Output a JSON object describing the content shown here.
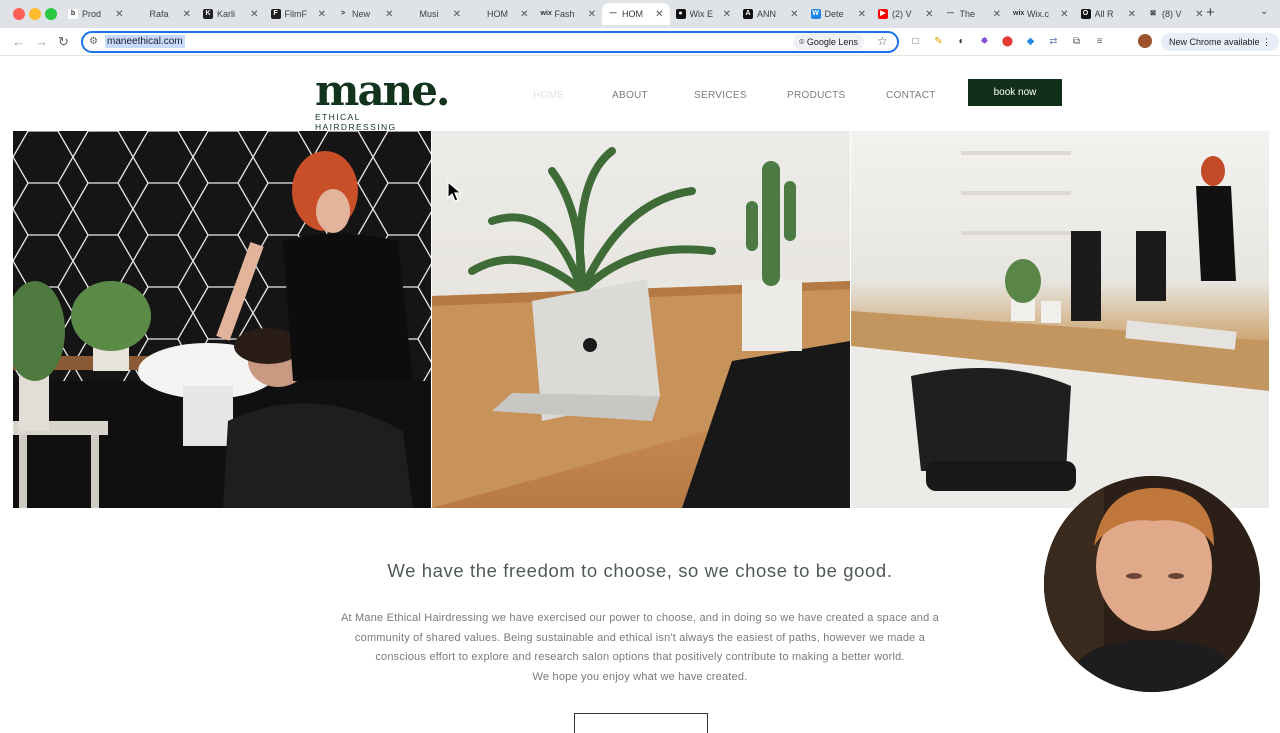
{
  "browser": {
    "tabs": [
      {
        "title": "Prod",
        "fav_color": "#ffffff",
        "fav_text": "b",
        "fav_text_color": "#333333"
      },
      {
        "title": "Rafa",
        "fav_color": "#dfe3e8",
        "fav_text": "",
        "fav_text_color": "#333333"
      },
      {
        "title": "Karli",
        "fav_color": "#222222",
        "fav_text": "K",
        "fav_text_color": "#ffffff"
      },
      {
        "title": "FilmF",
        "fav_color": "#1f1f1f",
        "fav_text": "F",
        "fav_text_color": "#ffffff"
      },
      {
        "title": "New",
        "fav_color": "#dfe3e8",
        "fav_text": ">",
        "fav_text_color": "#222222"
      },
      {
        "title": "Musi",
        "fav_color": "#dfe3e8",
        "fav_text": "",
        "fav_text_color": "#333333"
      },
      {
        "title": "HOM",
        "fav_color": "#dfe3e8",
        "fav_text": "",
        "fav_text_color": "#333333"
      },
      {
        "title": "Fash",
        "fav_color": "#dfe3e8",
        "fav_text": "wix",
        "fav_text_color": "#333333"
      },
      {
        "title": "HOM",
        "fav_color": "#ffffff",
        "fav_text": "—",
        "fav_text_color": "#333333",
        "active": true
      },
      {
        "title": "Wix E",
        "fav_color": "#111111",
        "fav_text": "●",
        "fav_text_color": "#ffffff"
      },
      {
        "title": "ANN",
        "fav_color": "#111111",
        "fav_text": "A",
        "fav_text_color": "#ffffff"
      },
      {
        "title": "Dete",
        "fav_color": "#1e88e5",
        "fav_text": "W",
        "fav_text_color": "#ffffff"
      },
      {
        "title": "(2) V",
        "fav_color": "#ff0000",
        "fav_text": "▶",
        "fav_text_color": "#ffffff"
      },
      {
        "title": "The",
        "fav_color": "#dfe3e8",
        "fav_text": "—",
        "fav_text_color": "#333333"
      },
      {
        "title": "Wix.c",
        "fav_color": "#dfe3e8",
        "fav_text": "wix",
        "fav_text_color": "#333333"
      },
      {
        "title": "All R",
        "fav_color": "#111111",
        "fav_text": "O",
        "fav_text_color": "#ffffff"
      },
      {
        "title": "(8) V",
        "fav_color": "#dfe3e8",
        "fav_text": "⊠",
        "fav_text_color": "#333333"
      }
    ],
    "url": "maneethical.com",
    "google_lens": "Google Lens",
    "new_chrome": "New Chrome available",
    "extensions": [
      {
        "icon": "□",
        "color": "#5f6368"
      },
      {
        "icon": "✎",
        "color": "#e0a100"
      },
      {
        "icon": "◐",
        "color": "#333333"
      },
      {
        "icon": "✸",
        "color": "#7b4bd6"
      },
      {
        "icon": "⬤",
        "color": "#e53935"
      },
      {
        "icon": "◆",
        "color": "#1e88e5"
      },
      {
        "icon": "⇄",
        "color": "#7d8cc4"
      },
      {
        "icon": "⧉",
        "color": "#5f6368"
      },
      {
        "icon": "≡",
        "color": "#5f6368"
      }
    ]
  },
  "site": {
    "logo": {
      "word": "mane.",
      "tagline": "ETHICAL HAIRDRESSING"
    },
    "nav": {
      "home": "HOME",
      "about": "ABOUT",
      "services": "SERVICES",
      "products": "PRODUCTS",
      "contact": "CONTACT"
    },
    "book_now": "book now",
    "headline": "We have the freedom to choose, so we chose to be good.",
    "body_lines": [
      "At Mane Ethical Hairdressing we have exercised our power to choose, and in doing so we have created a space and a",
      "community of shared values. Being sustainable and ethical isn't always the easiest of paths, however we made a",
      "conscious effort to explore and research salon options that positively contribute to making a better world.",
      "We hope you enjoy what we have created."
    ],
    "brand_color": "#12341d"
  }
}
